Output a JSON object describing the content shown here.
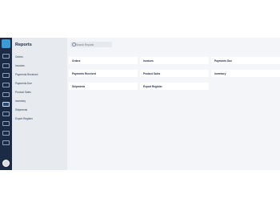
{
  "sidebar": {
    "title": "Reports",
    "items": [
      {
        "label": "Orders"
      },
      {
        "label": "Invoices"
      },
      {
        "label": "Payments Received"
      },
      {
        "label": "Payments Due"
      },
      {
        "label": "Product Sales"
      },
      {
        "label": "Inventory"
      },
      {
        "label": "Shipments"
      },
      {
        "label": "Export Register"
      }
    ]
  },
  "search": {
    "placeholder": "Search Reports"
  },
  "reports": [
    {
      "label": "Orders"
    },
    {
      "label": "Invoices"
    },
    {
      "label": "Payments Due"
    },
    {
      "label": "Payments Received"
    },
    {
      "label": "Product Sales"
    },
    {
      "label": "Inventory"
    },
    {
      "label": "Shipments"
    },
    {
      "label": "Export Register"
    }
  ]
}
